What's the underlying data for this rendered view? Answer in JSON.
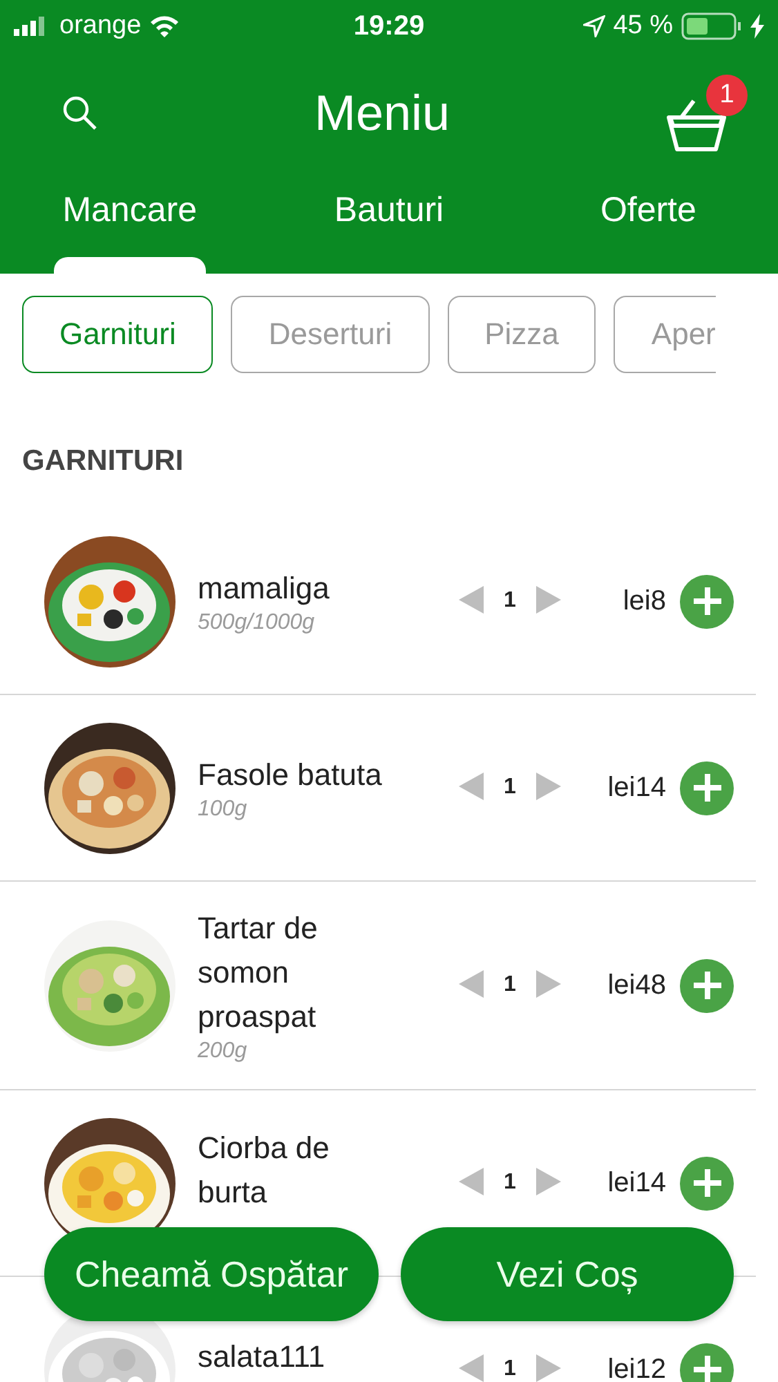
{
  "status_bar": {
    "carrier": "orange",
    "time": "19:29",
    "battery": "45 %"
  },
  "header": {
    "title": "Meniu",
    "cart_badge": "1"
  },
  "tabs": [
    {
      "label": "Mancare",
      "selected": true
    },
    {
      "label": "Bauturi",
      "selected": false
    },
    {
      "label": "Oferte",
      "selected": false
    }
  ],
  "categories": [
    {
      "label": "Garnituri",
      "selected": true
    },
    {
      "label": "Deserturi",
      "selected": false
    },
    {
      "label": "Pizza",
      "selected": false
    },
    {
      "label": "Aper",
      "selected": false
    }
  ],
  "section_title": "GARNITURI",
  "items": [
    {
      "name": "mamaliga",
      "weight": "500g/1000g",
      "quantity": "1",
      "price": "lei8"
    },
    {
      "name": "Fasole batuta",
      "weight": "100g",
      "quantity": "1",
      "price": "lei14"
    },
    {
      "name": "Tartar de somon proaspat",
      "weight": "200g",
      "quantity": "1",
      "price": "lei48"
    },
    {
      "name": "Ciorba de burta",
      "quantity": "1",
      "price": "lei14"
    },
    {
      "name": "salata111",
      "quantity": "1",
      "price": "lei12"
    }
  ],
  "buttons": [
    {
      "label": "Cheamă Ospătar"
    },
    {
      "label": "Vezi Coș"
    }
  ]
}
